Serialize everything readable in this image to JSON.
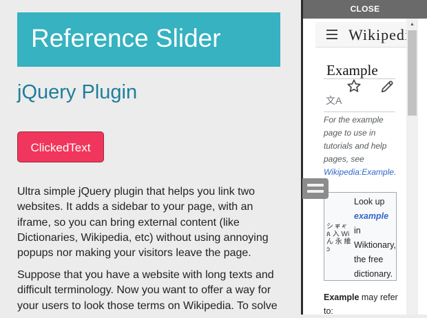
{
  "main": {
    "title": "Reference Slider",
    "subtitle": "jQuery Plugin",
    "button_label": "ClickedText",
    "paragraphs": [
      "Ultra simple jQuery plugin that helps you link two websites. It adds a sidebar to your page, with an iframe, so you can bring external content (like Dictionaries, Wikipedia, etc) without using annoying popups nor making your visitors leave the page.",
      "Suppose that you have a website with long texts and difficult terminology. Now you want to offer a way for your users to look those terms on Wikipedia. To solve"
    ]
  },
  "sidebar": {
    "close_label": "CLOSE",
    "wiki": {
      "logo_text": "Wikipedia",
      "page_title": "Example",
      "lang_icon_glyph": "文A",
      "hatnote_prefix": "For the example page to use in tutorials and help pages, see ",
      "hatnote_link": "Wikipedia:Example",
      "hatnote_suffix": ".",
      "wiktionary_logo_text": "シ ቐ 𐤀 ጰ 入 Wi ん 永 維 ↄ",
      "wiktionary_prefix": "Look up ",
      "wiktionary_term": "example",
      "wiktionary_suffix": " in Wiktionary, the free dictionary.",
      "body_bold": "Example",
      "body_rest": " may refer to:"
    }
  },
  "colors": {
    "hero_bg": "#36b2c0",
    "subtitle": "#1e7e9b",
    "button_bg": "#f0365c",
    "close_bar_bg": "#6a6a6a",
    "link": "#3366cc"
  },
  "icons": [
    "menu-icon",
    "star-icon",
    "pencil-icon",
    "language-icon",
    "wiktionary-logo",
    "drag-handle-icon",
    "scroll-up-arrow-icon"
  ]
}
